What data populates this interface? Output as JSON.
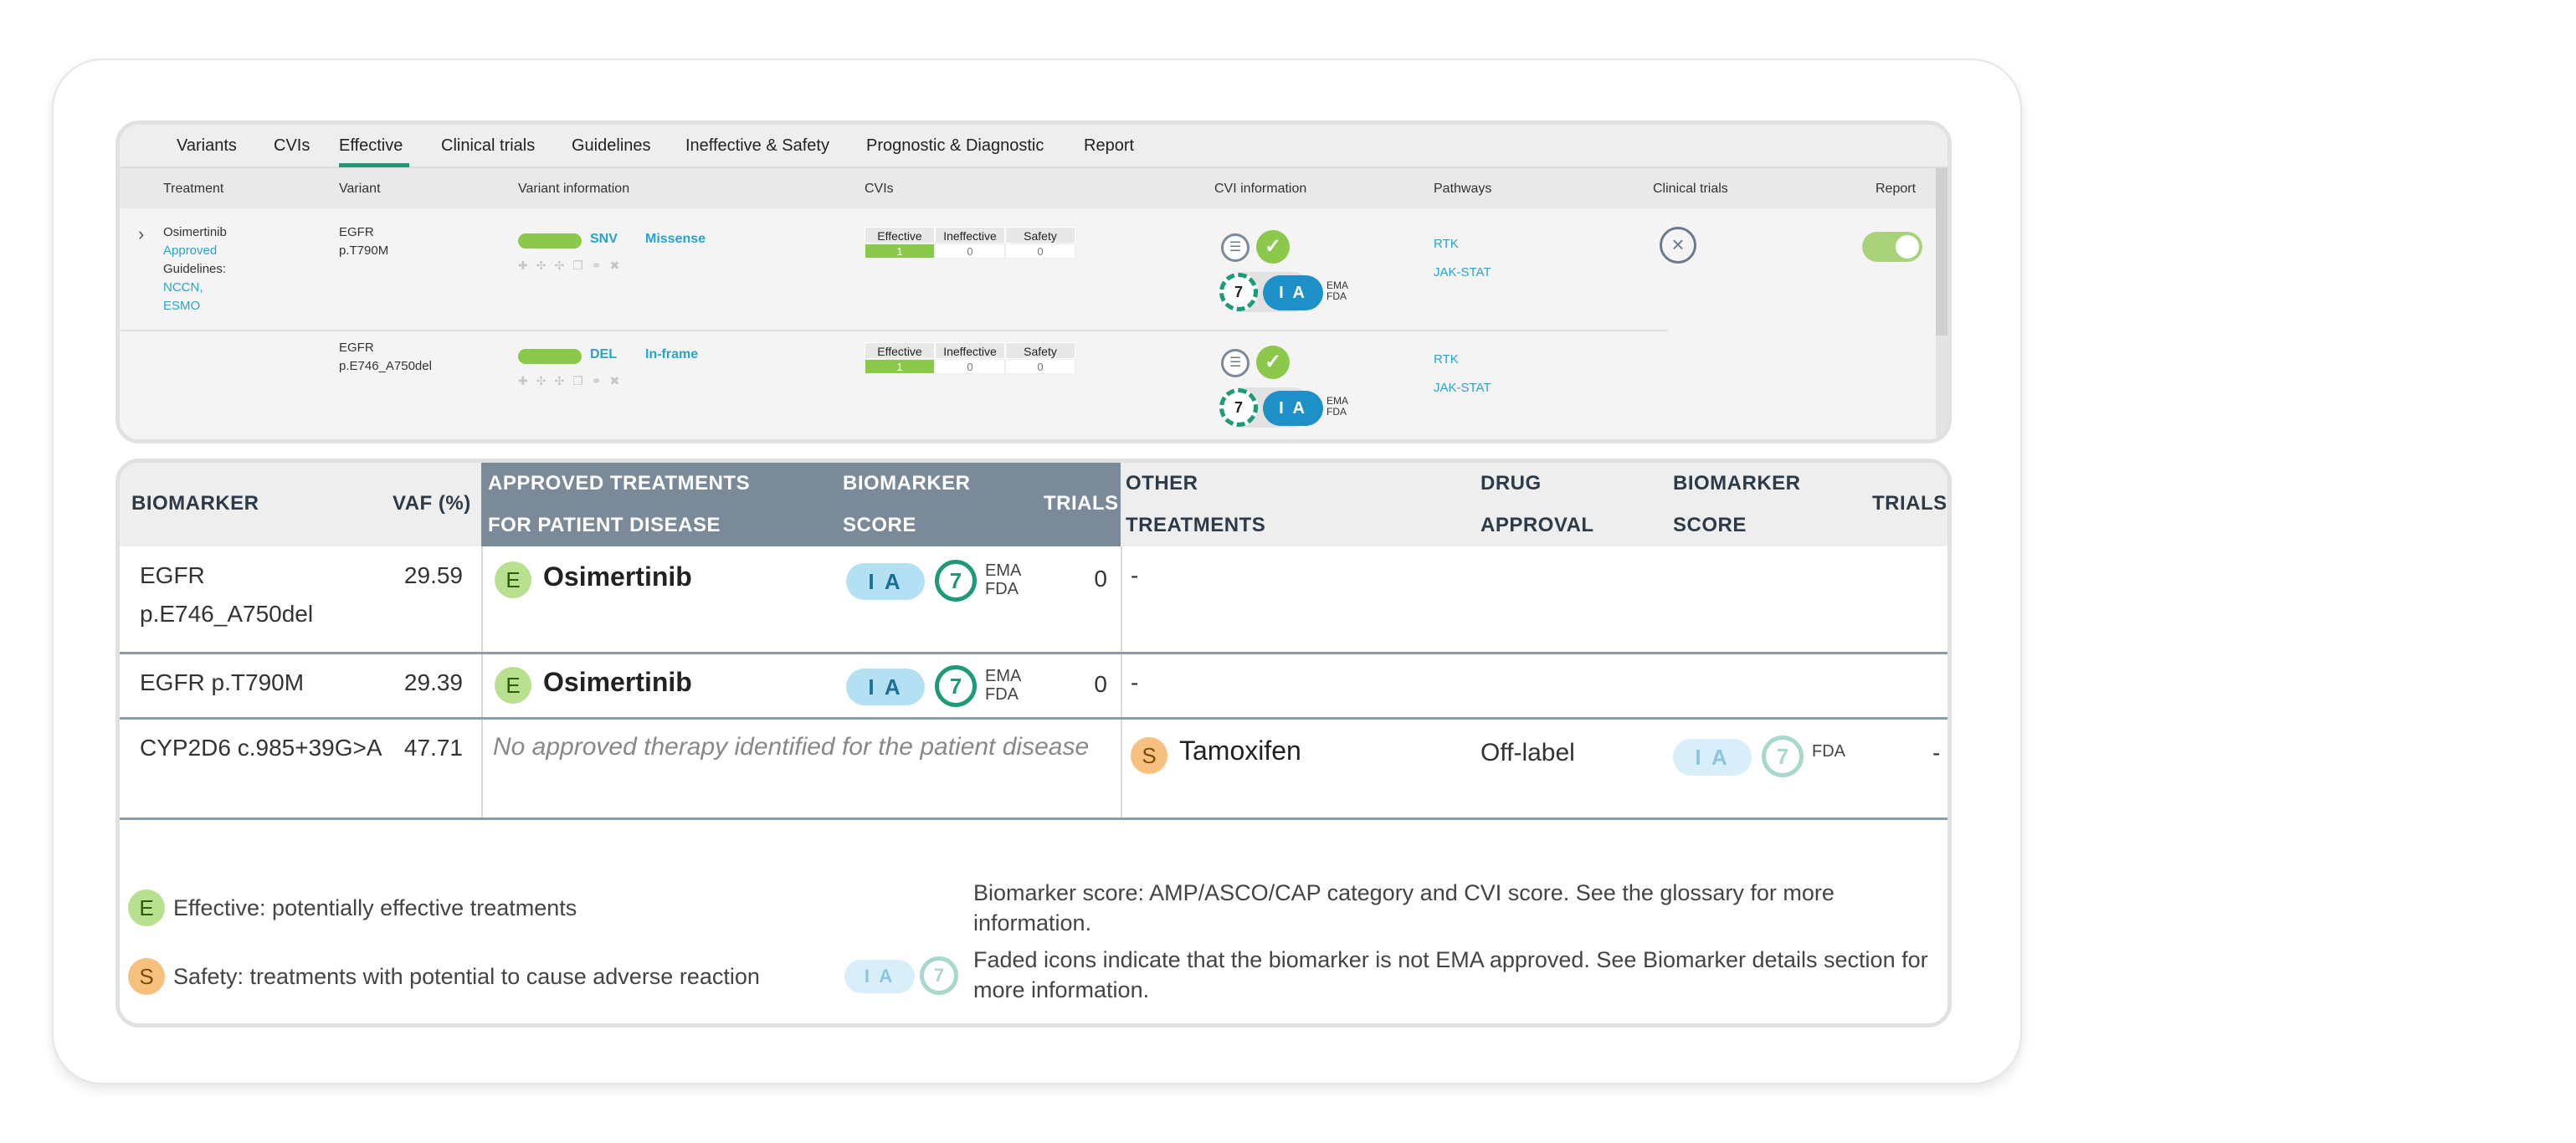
{
  "tabs": [
    "Variants",
    "CVIs",
    "Effective",
    "Clinical trials",
    "Guidelines",
    "Ineffective & Safety",
    "Prognostic & Diagnostic",
    "Report"
  ],
  "top_table": {
    "headers": {
      "treatment": "Treatment",
      "variant": "Variant",
      "variant_information": "Variant information",
      "cvis": "CVIs",
      "cvi_information": "CVI information",
      "pathways": "Pathways",
      "clinical_trials": "Clinical trials",
      "report": "Report"
    },
    "treatment": {
      "name": "Osimertinib",
      "status": "Approved",
      "guidelines_label": "Guidelines:",
      "guideline_1": "NCCN,",
      "guideline_2": "ESMO"
    },
    "cvi_labels": {
      "effective": "Effective",
      "ineffective": "Ineffective",
      "safety": "Safety"
    },
    "rows": [
      {
        "gene": "EGFR",
        "protein": "p.T790M",
        "type": "SNV",
        "consequence": "Missense",
        "effective": "1",
        "ineffective": "0",
        "safety": "0",
        "cvi_score": "7",
        "tier": "I A",
        "agency_1": "EMA",
        "agency_2": "FDA",
        "pathway_1": "RTK",
        "pathway_2": "JAK-STAT"
      },
      {
        "gene": "EGFR",
        "protein": "p.E746_A750del",
        "type": "DEL",
        "consequence": "In-frame",
        "effective": "1",
        "ineffective": "0",
        "safety": "0",
        "cvi_score": "7",
        "tier": "I A",
        "agency_1": "EMA",
        "agency_2": "FDA",
        "pathway_1": "RTK",
        "pathway_2": "JAK-STAT"
      }
    ]
  },
  "bottom_table": {
    "headers": {
      "biomarker": "BIOMARKER",
      "vaf": "VAF (%)",
      "approved_1": "APPROVED TREATMENTS",
      "approved_2": "FOR PATIENT DISEASE",
      "score_1": "BIOMARKER",
      "score_2": "SCORE",
      "trials": "TRIALS",
      "other_1": "OTHER",
      "other_2": "TREATMENTS",
      "approval_1": "DRUG",
      "approval_2": "APPROVAL",
      "score2_1": "BIOMARKER",
      "score2_2": "SCORE",
      "trials2": "TRIALS"
    },
    "rows": [
      {
        "biomarker_1": "EGFR",
        "biomarker_2": "p.E746_A750del",
        "vaf": "29.59",
        "badge": "E",
        "drug": "Osimertinib",
        "tier": "I A",
        "cvi": "7",
        "agency_1": "EMA",
        "agency_2": "FDA",
        "trials": "0",
        "other": "-"
      },
      {
        "biomarker_1": "EGFR p.T790M",
        "vaf": "29.39",
        "badge": "E",
        "drug": "Osimertinib",
        "tier": "I A",
        "cvi": "7",
        "agency_1": "EMA",
        "agency_2": "FDA",
        "trials": "0",
        "other": "-"
      },
      {
        "biomarker_1": "CYP2D6 c.985+39G>A",
        "vaf": "47.71",
        "note": "No approved therapy identified for the patient disease",
        "badge": "S",
        "other_drug": "Tamoxifen",
        "approval": "Off-label",
        "tier": "I A",
        "cvi": "7",
        "agency": "FDA",
        "trials": "-"
      }
    ]
  },
  "legend": {
    "effective_badge": "E",
    "effective_text": "Effective: potentially effective treatments",
    "safety_badge": "S",
    "safety_text": "Safety: treatments with potential to cause adverse reaction",
    "score_text": "Biomarker score: AMP/ASCO/CAP category and CVI score. See the glossary for more information.",
    "faded_tier": "I A",
    "faded_cvi": "7",
    "faded_text": "Faded icons indicate that the biomarker is not EMA approved. See Biomarker details section for more information."
  },
  "colors": {
    "accent_green": "#1e9a78",
    "effective_green": "#8cc84b",
    "link_blue": "#2aa3c8",
    "tier_blue": "#1e90c8",
    "header_slate": "#7a8a99"
  }
}
